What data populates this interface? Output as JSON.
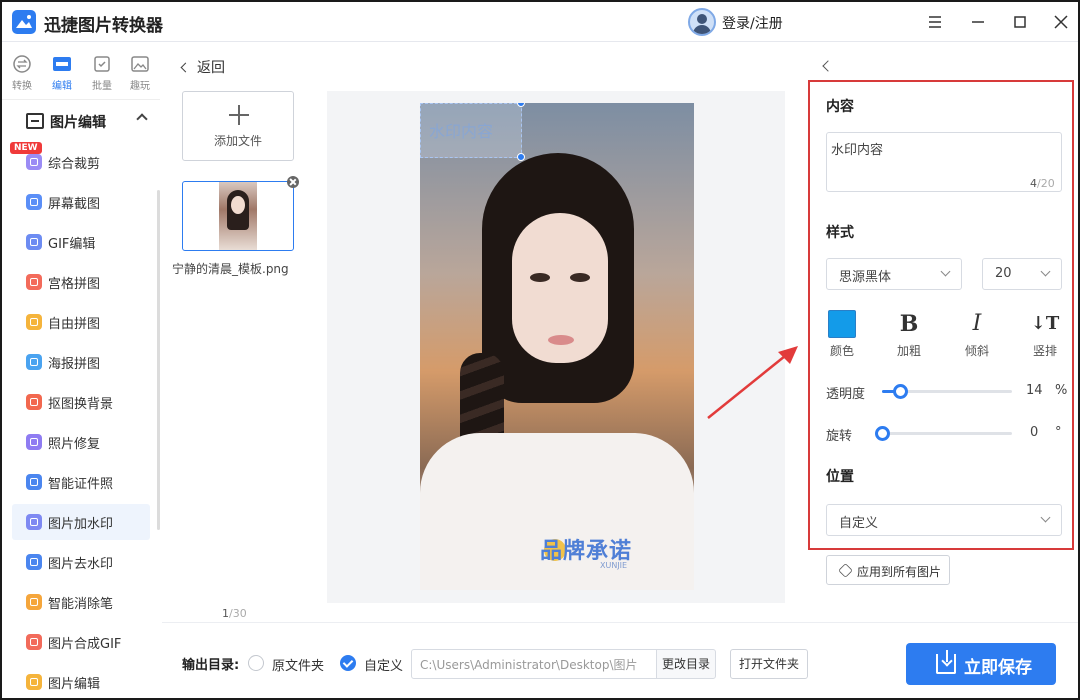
{
  "app": {
    "title": "迅捷图片转换器",
    "login": "登录/注册"
  },
  "nav_tabs": [
    {
      "label": "转换"
    },
    {
      "label": "编辑"
    },
    {
      "label": "批量"
    },
    {
      "label": "趣玩"
    }
  ],
  "sidebar": {
    "section_title": "图片编辑",
    "new_badge": "NEW",
    "items": [
      {
        "label": "综合裁剪",
        "color": "#9b8cf5"
      },
      {
        "label": "屏幕截图",
        "color": "#5b8ff7"
      },
      {
        "label": "GIF编辑",
        "color": "#6d8cf2"
      },
      {
        "label": "宫格拼图",
        "color": "#f36b5b"
      },
      {
        "label": "自由拼图",
        "color": "#f5b43c"
      },
      {
        "label": "海报拼图",
        "color": "#4aa3f0"
      },
      {
        "label": "抠图换背景",
        "color": "#f2684f"
      },
      {
        "label": "照片修复",
        "color": "#8f7cf2"
      },
      {
        "label": "智能证件照",
        "color": "#4b86ef"
      },
      {
        "label": "图片加水印",
        "color": "#7e89f2"
      },
      {
        "label": "图片去水印",
        "color": "#4b86ef"
      },
      {
        "label": "智能消除笔",
        "color": "#f5a63c"
      },
      {
        "label": "图片合成GIF",
        "color": "#f26b5b"
      },
      {
        "label": "图片编辑",
        "color": "#f5b43c"
      }
    ]
  },
  "main": {
    "back": "返回",
    "add_file": "添加文件",
    "file_name": "宁静的清晨_模板.png",
    "page_current": "1",
    "page_total": "/30",
    "watermark_preview": "水印内容",
    "brand_text": "品牌承诺",
    "brand_sub": "XUNJIE"
  },
  "panel": {
    "content_title": "内容",
    "watermark_text": "水印内容",
    "char_count": "4",
    "char_max": "/20",
    "style_title": "样式",
    "font": "思源黑体",
    "font_size": "20",
    "color_label": "颜色",
    "color_value": "#139be9",
    "bold_label": "加粗",
    "italic_label": "倾斜",
    "vertical_label": "竖排",
    "opacity_label": "透明度",
    "opacity_value": 14,
    "opacity_unit": "%",
    "rotate_label": "旋转",
    "rotate_value": 0,
    "rotate_unit": "°",
    "position_title": "位置",
    "position_value": "自定义",
    "apply_all": "应用到所有图片"
  },
  "bottom": {
    "output_label": "输出目录:",
    "original_folder": "原文件夹",
    "custom": "自定义",
    "path": "C:\\Users\\Administrator\\Desktop\\图片",
    "change_dir": "更改目录",
    "open_folder": "打开文件夹",
    "save": "立即保存"
  }
}
